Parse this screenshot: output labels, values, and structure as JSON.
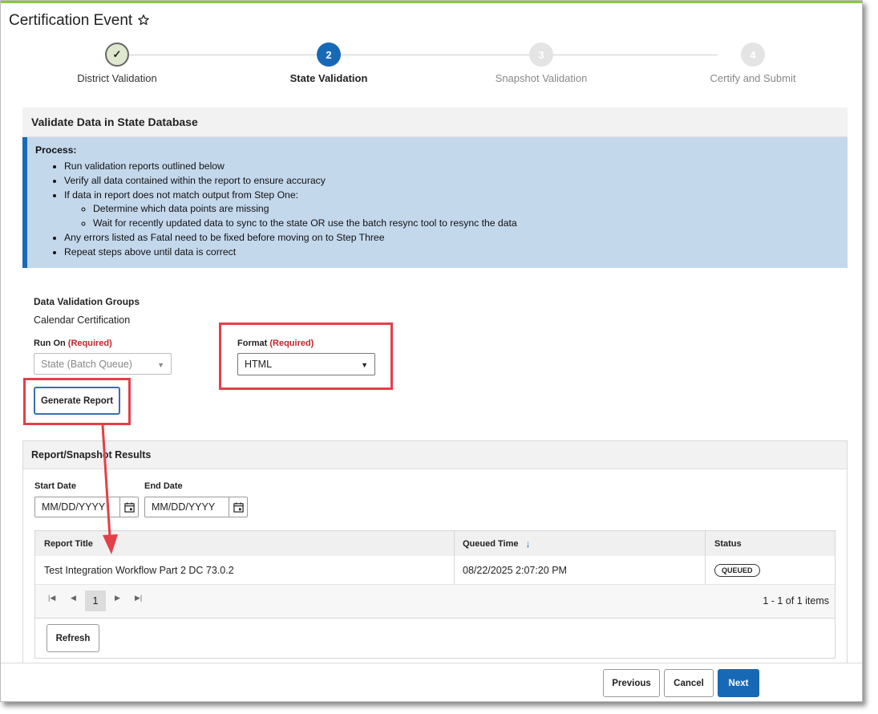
{
  "page": {
    "title": "Certification Event"
  },
  "stepper": {
    "steps": [
      {
        "number": "✓",
        "label": "District Validation",
        "state": "done"
      },
      {
        "number": "2",
        "label": "State Validation",
        "state": "current"
      },
      {
        "number": "3",
        "label": "Snapshot Validation",
        "state": "todo"
      },
      {
        "number": "4",
        "label": "Certify and Submit",
        "state": "todo"
      }
    ]
  },
  "section": {
    "title": "Validate Data in State Database",
    "process": {
      "title": "Process:",
      "items": [
        "Run validation reports outlined below",
        "Verify all data contained within the report to ensure accuracy",
        "If data in report does not match output from Step One:",
        "Determine which data points are missing",
        "Wait for recently updated data to sync to the state OR use the batch resync tool to resync the data",
        "Any errors listed as Fatal need to be fixed before moving on to Step Three",
        "Repeat steps above until data is correct"
      ]
    }
  },
  "form": {
    "groups_label": "Data Validation Groups",
    "groups_value": "Calendar Certification",
    "run_on_label": "Run On",
    "required": "(Required)",
    "run_on_value": "State (Batch Queue)",
    "format_label": "Format",
    "format_value": "HTML",
    "generate_label": "Generate Report"
  },
  "results": {
    "title": "Report/Snapshot Results",
    "start_label": "Start Date",
    "end_label": "End Date",
    "date_placeholder": "MM/DD/YYYY",
    "columns": {
      "title": "Report Title",
      "queued": "Queued Time",
      "status": "Status"
    },
    "rows": [
      {
        "title": "Test Integration Workflow Part 2 DC 73.0.2",
        "queued": "08/22/2025 2:07:20 PM",
        "status": "QUEUED"
      }
    ],
    "page": "1",
    "count": "1 - 1 of 1 items",
    "refresh_label": "Refresh"
  },
  "footer": {
    "previous": "Previous",
    "cancel": "Cancel",
    "next": "Next"
  },
  "colors": {
    "accent": "#1769b6",
    "highlight": "#e53f48",
    "required": "#c0262d"
  }
}
